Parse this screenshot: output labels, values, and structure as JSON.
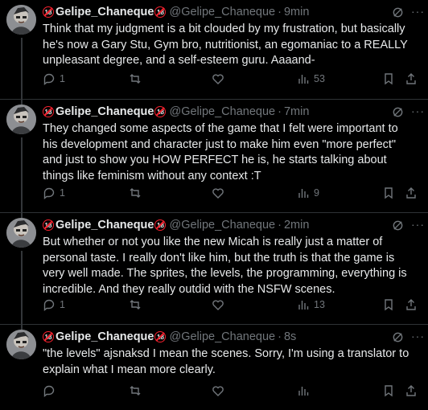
{
  "posts": [
    {
      "display_name": "Gelipe_Chaneque",
      "handle": "@Gelipe_Chaneque",
      "time": "9min",
      "text": "Think that my judgment is a bit clouded by my frustration, but basically he's now a Gary Stu, Gym bro, nutritionist, an egomaniac to a REALLY unpleasant degree, and a self-esteem guru. Aaaand-",
      "replies": "1",
      "reposts": "",
      "likes": "",
      "views": "53"
    },
    {
      "display_name": "Gelipe_Chaneque",
      "handle": "@Gelipe_Chaneque",
      "time": "7min",
      "text": "They changed some aspects of the game that I felt were important to his development and character just to make him even \"more perfect\" and just to show you HOW PERFECT he is, he starts talking about things like feminism without any context :T",
      "replies": "1",
      "reposts": "",
      "likes": "",
      "views": "9"
    },
    {
      "display_name": "Gelipe_Chaneque",
      "handle": "@Gelipe_Chaneque",
      "time": "2min",
      "text": "But whether or not you like the new Micah is really just a matter of personal taste. I really don't like him, but the truth is that the game is very well made. The sprites, the levels, the programming, everything is incredible. And they really outdid with the NSFW scenes.",
      "replies": "1",
      "reposts": "",
      "likes": "",
      "views": "13"
    },
    {
      "display_name": "Gelipe_Chaneque",
      "handle": "@Gelipe_Chaneque",
      "time": "8s",
      "text": "\"the levels\" ajsnaksd I mean the scenes. Sorry, I'm using a translator to explain what I mean more clearly.",
      "replies": "",
      "reposts": "",
      "likes": "",
      "views": ""
    }
  ],
  "badge_text": "18",
  "separator": "·",
  "more_glyph": "···",
  "colors": {
    "background": "#000000",
    "text": "#e7e9ea",
    "muted": "#71767b",
    "divider": "#2f3336",
    "badge_red": "#f4212e"
  },
  "icons": [
    "grok-icon",
    "more-icon",
    "reply-icon",
    "repost-icon",
    "like-icon",
    "views-icon",
    "bookmark-icon",
    "share-icon",
    "age-18-badge-icon"
  ]
}
